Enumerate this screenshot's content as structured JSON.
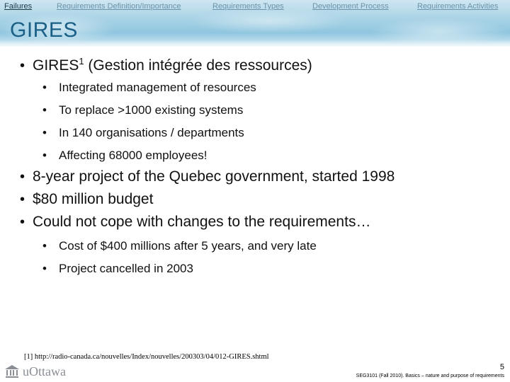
{
  "nav": {
    "items": [
      {
        "label": "Failures",
        "active": true
      },
      {
        "label": "Requirements Definition/Importance",
        "active": false
      },
      {
        "label": "Requirements Types",
        "active": false
      },
      {
        "label": "Development Process",
        "active": false
      },
      {
        "label": "Requirements Activities",
        "active": false
      }
    ]
  },
  "slide": {
    "title": "GIRES",
    "bullets": [
      {
        "text": "GIRES",
        "sup": "1",
        "text_after": " (Gestion intégrée des ressources)",
        "sub": [
          "Integrated management of resources",
          "To replace >1000 existing systems",
          "In 140 organisations / departments",
          "Affecting 68000 employees!"
        ]
      },
      {
        "text": "8-year project of the Quebec government, started 1998"
      },
      {
        "text": "$80 million budget"
      },
      {
        "text": "Could not cope with changes to the requirements…",
        "sub2": [
          "Cost of $400 millions after 5 years, and very late",
          "Project cancelled in 2003"
        ]
      }
    ],
    "bullet_glyph": "•",
    "footnote": "[1] http://radio-canada.ca/nouvelles/Index/nouvelles/200303/04/012-GIRES.shtml"
  },
  "footer": {
    "logo_text": "uOttawa",
    "page_number": "5",
    "course": "SEG3101 (Fall 2010).   Basics – nature and purpose of requirements"
  },
  "colors": {
    "title": "#1a5f86",
    "nav_inactive": "#6b93a8",
    "nav_active": "#1a3a4a"
  }
}
